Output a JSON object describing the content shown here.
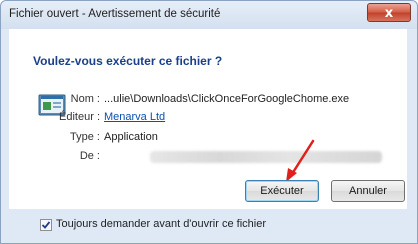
{
  "window": {
    "title": "Fichier ouvert - Avertissement de sécurité",
    "close_symbol": "x"
  },
  "dialog": {
    "heading": "Voulez-vous exécuter ce fichier ?",
    "icon": "application-icon",
    "fields": {
      "name_label": "Nom :",
      "name_value": "...ulie\\Downloads\\ClickOnceForGoogleChome.exe",
      "publisher_label": "Éditeur :",
      "publisher_value": "Menarva Ltd",
      "type_label": "Type :",
      "type_value": "Application",
      "from_label": "De :"
    },
    "buttons": {
      "run": "Exécuter",
      "cancel": "Annuler"
    },
    "checkbox": {
      "label": "Toujours demander avant d'ouvrir ce fichier",
      "checked": true
    },
    "annotation": {
      "arrow_color": "#e0201b"
    }
  }
}
